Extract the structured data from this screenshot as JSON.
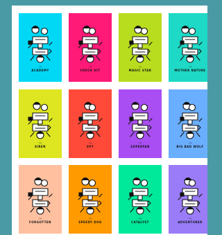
{
  "gallery": {
    "cards": [
      {
        "title": "ACADEMY",
        "subtitle": "THE",
        "bg": "#00d8f6",
        "icon": "academy-figures-icon"
      },
      {
        "title": "CROCK HIT",
        "subtitle": "THE",
        "bg": "#ff1a78",
        "icon": "crock-hit-figures-icon"
      },
      {
        "title": "MAGIC STAR",
        "subtitle": "THE",
        "bg": "#b8dc1e",
        "icon": "magic-star-figures-icon"
      },
      {
        "title": "MOTHER NATURE",
        "subtitle": "THE",
        "bg": "#1ed9c6",
        "icon": "mother-nature-figures-icon"
      },
      {
        "title": "SIREN",
        "subtitle": "THE",
        "bg": "#dde620",
        "icon": "siren-figures-icon"
      },
      {
        "title": "SPY",
        "subtitle": "THE",
        "bg": "#ff4a3a",
        "icon": "spy-figures-icon"
      },
      {
        "title": "SUPERFAN",
        "subtitle": "THE",
        "bg": "#a84ef2",
        "icon": "superfan-figures-icon"
      },
      {
        "title": "BIG BAD WOLF",
        "subtitle": "THE",
        "bg": "#6aaeff",
        "icon": "big-bad-wolf-figures-icon"
      },
      {
        "title": "FORGOTTEN",
        "subtitle": "THE",
        "bg": "#ffc0a0",
        "icon": "forgotten-figures-icon"
      },
      {
        "title": "SPEEDY DOG",
        "subtitle": "THE",
        "bg": "#ff9a00",
        "icon": "speedy-dog-figures-icon"
      },
      {
        "title": "CATALYST",
        "subtitle": "THE",
        "bg": "#00e89a",
        "icon": "catalyst-figures-icon"
      },
      {
        "title": "ADVENTURER",
        "subtitle": "THE",
        "bg": "#9a7cf8",
        "icon": "adventurer-figures-icon"
      }
    ]
  }
}
